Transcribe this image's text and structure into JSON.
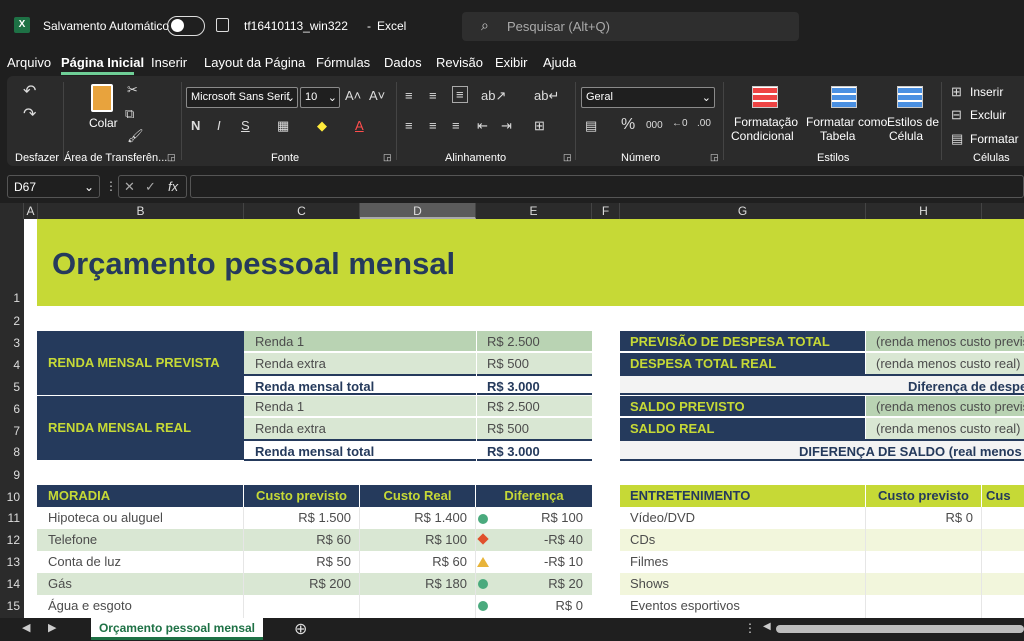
{
  "titlebar": {
    "autosave_label": "Salvamento Automático",
    "filename": "tf16410113_win322",
    "separator": "-",
    "app_name": "Excel",
    "search_placeholder": "Pesquisar (Alt+Q)"
  },
  "menu": [
    "Arquivo",
    "Página Inicial",
    "Inserir",
    "Layout da Página",
    "Fórmulas",
    "Dados",
    "Revisão",
    "Exibir",
    "Ajuda"
  ],
  "ribbon": {
    "groups": {
      "undo": "Desfazer",
      "clipboard": "Área de Transferên...",
      "font": "Fonte",
      "alignment": "Alinhamento",
      "number": "Número",
      "styles": "Estilos",
      "cells": "Células"
    },
    "paste_label": "Colar",
    "font_name": "Microsoft Sans Serif",
    "font_size": "10",
    "number_format": "Geral",
    "cond_format": [
      "Formatação",
      "Condicional"
    ],
    "format_table": [
      "Formatar como",
      "Tabela"
    ],
    "cell_styles": [
      "Estilos de",
      "Célula"
    ],
    "insert": "Inserir",
    "delete": "Excluir",
    "format": "Formatar"
  },
  "formula_bar": {
    "name_box": "D67",
    "fx": "fx"
  },
  "columns": [
    "A",
    "B",
    "C",
    "D",
    "E",
    "F",
    "G",
    "H"
  ],
  "rows": [
    "1",
    "2",
    "3",
    "4",
    "5",
    "6",
    "7",
    "8",
    "9",
    "10",
    "11",
    "12",
    "13",
    "14",
    "15"
  ],
  "sheet": {
    "title": "Orçamento pessoal mensal",
    "renda_prevista": {
      "label": "RENDA MENSAL PREVISTA",
      "rows": [
        {
          "name": "Renda 1",
          "value": "R$ 2.500"
        },
        {
          "name": "Renda extra",
          "value": "R$ 500"
        },
        {
          "name": "Renda mensal total",
          "value": "R$ 3.000"
        }
      ]
    },
    "renda_real": {
      "label": "RENDA MENSAL REAL",
      "rows": [
        {
          "name": "Renda 1",
          "value": "R$ 2.500"
        },
        {
          "name": "Renda extra",
          "value": "R$ 500"
        },
        {
          "name": "Renda mensal total",
          "value": "R$ 3.000"
        }
      ]
    },
    "summary": [
      {
        "label": "PREVISÃO DE DESPESA TOTAL",
        "note": "(renda menos custo previsto)"
      },
      {
        "label": "DESPESA TOTAL REAL",
        "note": "(renda menos custo real)"
      },
      {
        "label": "SALDO PREVISTO",
        "note": "(renda menos custo previsto)"
      },
      {
        "label": "SALDO REAL",
        "note": "(renda menos custo real)"
      }
    ],
    "diff_expense": "Diferença de despesa",
    "diff_balance": "DIFERENÇA DE SALDO (real menos previsto)",
    "moradia": {
      "headers": [
        "MORADIA",
        "Custo previsto",
        "Custo Real",
        "Diferença"
      ],
      "rows": [
        {
          "item": "Hipoteca ou aluguel",
          "prev": "R$ 1.500",
          "real": "R$ 1.400",
          "diff": "R$ 100",
          "ind": "circle"
        },
        {
          "item": "Telefone",
          "prev": "R$ 60",
          "real": "R$ 100",
          "diff": "-R$ 40",
          "ind": "diamond"
        },
        {
          "item": "Conta de luz",
          "prev": "R$ 50",
          "real": "R$ 60",
          "diff": "-R$ 10",
          "ind": "triangle"
        },
        {
          "item": "Gás",
          "prev": "R$ 200",
          "real": "R$ 180",
          "diff": "R$ 20",
          "ind": "circle"
        },
        {
          "item": "Água e esgoto",
          "prev": "",
          "real": "",
          "diff": "R$ 0",
          "ind": "circle"
        }
      ]
    },
    "entretenimento": {
      "headers": [
        "ENTRETENIMENTO",
        "Custo previsto",
        "Cus"
      ],
      "rows": [
        {
          "item": "Vídeo/DVD",
          "prev": "R$ 0"
        },
        {
          "item": "CDs",
          "prev": ""
        },
        {
          "item": "Filmes",
          "prev": ""
        },
        {
          "item": "Shows",
          "prev": ""
        },
        {
          "item": "Eventos esportivos",
          "prev": ""
        }
      ]
    }
  },
  "sheet_tab": "Orçamento pessoal mensal",
  "colors": {
    "navy": "#253a5c",
    "lime": "#c6d936",
    "sheet_tab_green": "#1e7145"
  }
}
